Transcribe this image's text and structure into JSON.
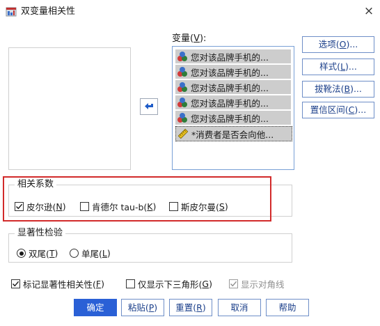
{
  "window": {
    "title": "双变量相关性",
    "close_symbol": "×"
  },
  "variables_panel": {
    "label_prefix": "变量(",
    "label_key": "V",
    "label_suffix": "):",
    "items": [
      {
        "label": "您对该品牌手机的...",
        "icon": "nominal-variable-icon"
      },
      {
        "label": "您对该品牌手机的...",
        "icon": "nominal-variable-icon"
      },
      {
        "label": "您对该品牌手机的...",
        "icon": "nominal-variable-icon"
      },
      {
        "label": "您对该品牌手机的...",
        "icon": "nominal-variable-icon"
      },
      {
        "label": "您对该品牌手机的...",
        "icon": "nominal-variable-icon"
      },
      {
        "label": "*消费者是否会向他...",
        "icon": "scale-variable-icon"
      }
    ]
  },
  "side_buttons": {
    "options": {
      "prefix": "选项(",
      "key": "O",
      "suffix": ")..."
    },
    "style": {
      "prefix": "样式(",
      "key": "L",
      "suffix": ")..."
    },
    "bootstrap": {
      "prefix": "拔靴法(",
      "key": "B",
      "suffix": ")..."
    },
    "confidence": {
      "prefix": "置信区间(",
      "key": "C",
      "suffix": ")..."
    }
  },
  "correlation_group": {
    "title": "相关系数",
    "pearson": {
      "prefix": "皮尔逊(",
      "key": "N",
      "suffix": ")",
      "checked": true
    },
    "kendall": {
      "prefix": "肯德尔 tau-b(",
      "key": "K",
      "suffix": ")",
      "checked": false
    },
    "spearman": {
      "prefix": "斯皮尔曼(",
      "key": "S",
      "suffix": ")",
      "checked": false
    }
  },
  "significance_group": {
    "title": "显著性检验",
    "two_tailed": {
      "prefix": "双尾(",
      "key": "T",
      "suffix": ")",
      "selected": true
    },
    "one_tailed": {
      "prefix": "单尾(",
      "key": "L",
      "suffix": ")",
      "selected": false
    }
  },
  "bottom_options": {
    "flag_significant": {
      "prefix": "标记显著性相关性(",
      "key": "F",
      "suffix": ")",
      "checked": true
    },
    "lower_triangle": {
      "prefix": "仅显示下三角形(",
      "key": "G",
      "suffix": ")",
      "checked": false
    },
    "show_diagonal": {
      "label": "显示对角线",
      "checked": true,
      "disabled": true
    }
  },
  "bottom_buttons": {
    "ok": {
      "label": "确定"
    },
    "paste": {
      "prefix": "粘贴(",
      "key": "P",
      "suffix": ")"
    },
    "reset": {
      "prefix": "重置(",
      "key": "R",
      "suffix": ")"
    },
    "cancel": {
      "label": "取消"
    },
    "help": {
      "label": "帮助"
    }
  },
  "colors": {
    "primary_button": "#2a60d6",
    "highlight_border": "#d22a2a",
    "list_selection": "#cdcdcd"
  }
}
